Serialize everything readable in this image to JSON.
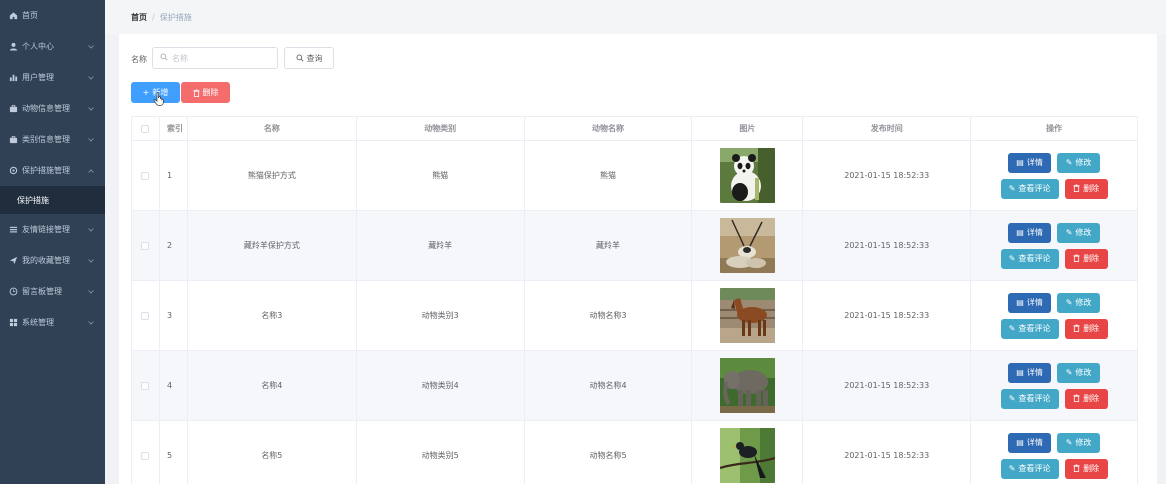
{
  "sidebar": {
    "items": [
      {
        "label": "首页",
        "icon": "home-icon",
        "has_children": false
      },
      {
        "label": "个人中心",
        "icon": "user-icon",
        "has_children": true
      },
      {
        "label": "用户管理",
        "icon": "chart-icon",
        "has_children": true
      },
      {
        "label": "动物信息管理",
        "icon": "briefcase-icon",
        "has_children": true
      },
      {
        "label": "类别信息管理",
        "icon": "briefcase-icon",
        "has_children": true
      },
      {
        "label": "保护措施管理",
        "icon": "settings-icon",
        "has_children": true,
        "expanded": true
      },
      {
        "label": "友情链接管理",
        "icon": "list-icon",
        "has_children": true
      },
      {
        "label": "我的收藏管理",
        "icon": "send-icon",
        "has_children": true
      },
      {
        "label": "留言板管理",
        "icon": "clock-icon",
        "has_children": true
      },
      {
        "label": "系统管理",
        "icon": "grid-icon",
        "has_children": true
      }
    ],
    "sub_active": "保护措施"
  },
  "breadcrumb": {
    "home": "首页",
    "separator": "/",
    "current": "保护措施"
  },
  "search": {
    "label": "名称",
    "placeholder": "名称",
    "query_label": "查询"
  },
  "actions": {
    "add_label": "新增",
    "delete_label": "删除"
  },
  "table": {
    "headers": {
      "index": "索引",
      "name": "名称",
      "type": "动物类别",
      "animal_name": "动物名称",
      "picture": "图片",
      "time": "发布时间",
      "ops": "操作"
    },
    "op_labels": {
      "detail": "详情",
      "edit": "修改",
      "comment": "查看评论",
      "remove": "删除"
    },
    "rows": [
      {
        "index": "1",
        "name": "熊猫保护方式",
        "type": "熊猫",
        "animal_name": "熊猫",
        "picture": "panda",
        "time": "2021-01-15 18:52:33"
      },
      {
        "index": "2",
        "name": "藏羚羊保护方式",
        "type": "藏羚羊",
        "animal_name": "藏羚羊",
        "picture": "antelope",
        "time": "2021-01-15 18:52:33"
      },
      {
        "index": "3",
        "name": "名称3",
        "type": "动物类别3",
        "animal_name": "动物名称3",
        "picture": "horse",
        "time": "2021-01-15 18:52:33"
      },
      {
        "index": "4",
        "name": "名称4",
        "type": "动物类别4",
        "animal_name": "动物名称4",
        "picture": "elephant",
        "time": "2021-01-15 18:52:33"
      },
      {
        "index": "5",
        "name": "名称5",
        "type": "动物类别5",
        "animal_name": "动物名称5",
        "picture": "bird",
        "time": "2021-01-15 18:52:33"
      }
    ]
  },
  "colors": {
    "sidebar_bg": "#304156",
    "primary": "#409eff",
    "danger": "#f56c6c",
    "info": "#43a8c8",
    "detail": "#2e6ab3"
  }
}
